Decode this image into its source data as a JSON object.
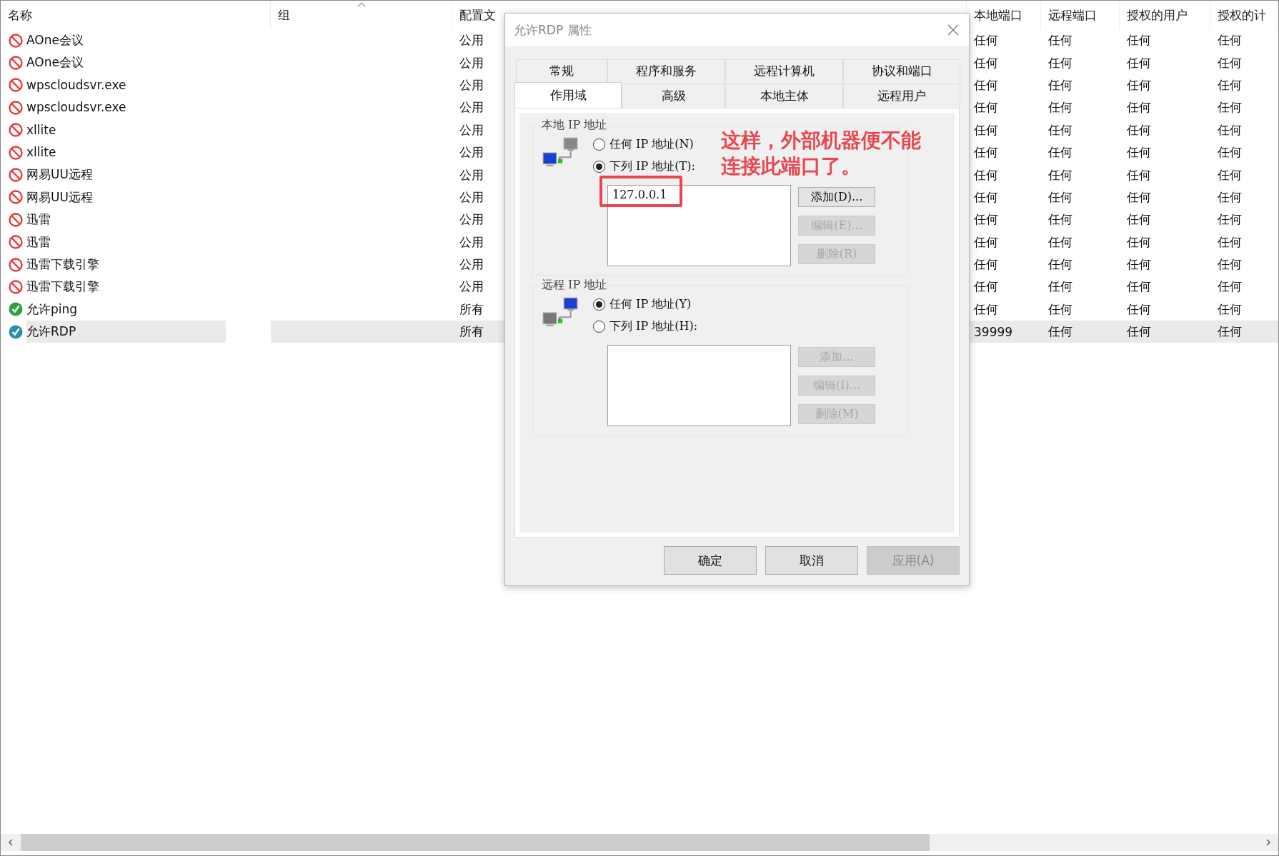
{
  "table": {
    "columns": [
      {
        "label": "名称",
        "sorted": false
      },
      {
        "label": "组",
        "sorted": true
      },
      {
        "label": "配置文",
        "sorted": false
      },
      {
        "label": "本地端口",
        "sorted": false
      },
      {
        "label": "远程端口",
        "sorted": false
      },
      {
        "label": "授权的用户",
        "sorted": false
      },
      {
        "label": "授权的计",
        "sorted": false
      }
    ],
    "rows": [
      {
        "kind": "blocked",
        "name": "AOne会议",
        "profile": "公用",
        "local_port": "任何",
        "remote_port": "任何",
        "users": "任何",
        "computers": "任何",
        "selected": false
      },
      {
        "kind": "blocked",
        "name": "AOne会议",
        "profile": "公用",
        "local_port": "任何",
        "remote_port": "任何",
        "users": "任何",
        "computers": "任何",
        "selected": false
      },
      {
        "kind": "blocked",
        "name": "wpscloudsvr.exe",
        "profile": "公用",
        "local_port": "任何",
        "remote_port": "任何",
        "users": "任何",
        "computers": "任何",
        "selected": false
      },
      {
        "kind": "blocked",
        "name": "wpscloudsvr.exe",
        "profile": "公用",
        "local_port": "任何",
        "remote_port": "任何",
        "users": "任何",
        "computers": "任何",
        "selected": false
      },
      {
        "kind": "blocked",
        "name": "xllite",
        "profile": "公用",
        "local_port": "任何",
        "remote_port": "任何",
        "users": "任何",
        "computers": "任何",
        "selected": false
      },
      {
        "kind": "blocked",
        "name": "xllite",
        "profile": "公用",
        "local_port": "任何",
        "remote_port": "任何",
        "users": "任何",
        "computers": "任何",
        "selected": false
      },
      {
        "kind": "blocked",
        "name": "网易UU远程",
        "profile": "公用",
        "local_port": "任何",
        "remote_port": "任何",
        "users": "任何",
        "computers": "任何",
        "selected": false
      },
      {
        "kind": "blocked",
        "name": "网易UU远程",
        "profile": "公用",
        "local_port": "任何",
        "remote_port": "任何",
        "users": "任何",
        "computers": "任何",
        "selected": false
      },
      {
        "kind": "blocked",
        "name": "迅雷",
        "profile": "公用",
        "local_port": "任何",
        "remote_port": "任何",
        "users": "任何",
        "computers": "任何",
        "selected": false
      },
      {
        "kind": "blocked",
        "name": "迅雷",
        "profile": "公用",
        "local_port": "任何",
        "remote_port": "任何",
        "users": "任何",
        "computers": "任何",
        "selected": false
      },
      {
        "kind": "blocked",
        "name": "迅雷下载引擎",
        "profile": "公用",
        "local_port": "任何",
        "remote_port": "任何",
        "users": "任何",
        "computers": "任何",
        "selected": false
      },
      {
        "kind": "blocked",
        "name": "迅雷下载引擎",
        "profile": "公用",
        "local_port": "任何",
        "remote_port": "任何",
        "users": "任何",
        "computers": "任何",
        "selected": false
      },
      {
        "kind": "allowed",
        "name": "允许ping",
        "profile": "所有",
        "local_port": "任何",
        "remote_port": "任何",
        "users": "任何",
        "computers": "任何",
        "selected": false
      },
      {
        "kind": "allowed",
        "name": "允许RDP",
        "profile": "所有",
        "local_port": "39999",
        "remote_port": "任何",
        "users": "任何",
        "computers": "任何",
        "selected": true
      }
    ]
  },
  "dialog": {
    "title": "允许RDP 属性",
    "tab_rows": [
      [
        {
          "label": "常规",
          "selected": false
        },
        {
          "label": "程序和服务",
          "selected": false
        },
        {
          "label": "远程计算机",
          "selected": false
        },
        {
          "label": "协议和端口",
          "selected": false
        }
      ],
      [
        {
          "label": "作用域",
          "selected": true
        },
        {
          "label": "高级",
          "selected": false
        },
        {
          "label": "本地主体",
          "selected": false
        },
        {
          "label": "远程用户",
          "selected": false
        }
      ]
    ],
    "groups": [
      {
        "title": "本地 IP 地址",
        "options": [
          {
            "label": "任何 IP 地址(N)",
            "selected": false
          },
          {
            "label": "下列 IP 地址(T):",
            "selected": true
          }
        ],
        "entries": [
          "127.0.0.1"
        ],
        "buttons": [
          {
            "label": "添加(D)...",
            "disabled": false
          },
          {
            "label": "编辑(E)...",
            "disabled": true
          },
          {
            "label": "删除(R)",
            "disabled": true
          }
        ]
      },
      {
        "title": "远程 IP 地址",
        "options": [
          {
            "label": "任何 IP 地址(Y)",
            "selected": true
          },
          {
            "label": "下列 IP 地址(H):",
            "selected": false
          }
        ],
        "buttons": [
          {
            "label": "添加...",
            "disabled": true
          },
          {
            "label": "编辑(I)...",
            "disabled": true
          },
          {
            "label": "删除(M)",
            "disabled": true
          }
        ]
      }
    ],
    "annotation": "这样，外部机器便不能连接此端口了。",
    "buttons": [
      {
        "label": "确定",
        "disabled": false
      },
      {
        "label": "取消",
        "disabled": false
      },
      {
        "label": "应用(A)",
        "disabled": true
      }
    ]
  }
}
